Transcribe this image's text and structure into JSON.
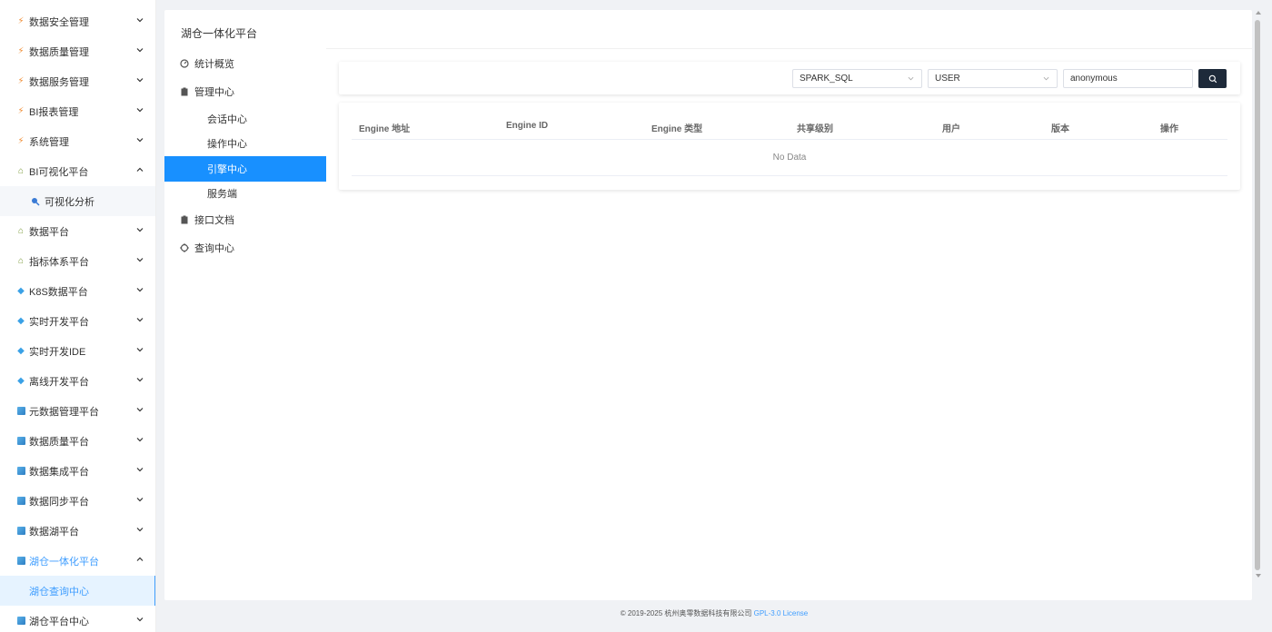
{
  "sidebar": {
    "items": [
      {
        "label": "数据安全管理",
        "icon": "bolt-icon",
        "expanded": false
      },
      {
        "label": "数据质量管理",
        "icon": "bolt-icon",
        "expanded": false
      },
      {
        "label": "数据服务管理",
        "icon": "bolt-icon",
        "expanded": false
      },
      {
        "label": "BI报表管理",
        "icon": "bolt-icon",
        "expanded": false
      },
      {
        "label": "系统管理",
        "icon": "bolt-icon",
        "expanded": false
      },
      {
        "label": "BI可视化平台",
        "icon": "tree-icon",
        "expanded": true
      },
      {
        "label": "数据平台",
        "icon": "tree-icon",
        "expanded": false
      },
      {
        "label": "指标体系平台",
        "icon": "tree-icon",
        "expanded": false
      },
      {
        "label": "K8S数据平台",
        "icon": "gem-icon",
        "expanded": false
      },
      {
        "label": "实时开发平台",
        "icon": "gem-icon",
        "expanded": false
      },
      {
        "label": "实时开发IDE",
        "icon": "gem-icon",
        "expanded": false
      },
      {
        "label": "离线开发平台",
        "icon": "gem-icon",
        "expanded": false
      },
      {
        "label": "元数据管理平台",
        "icon": "cube-icon",
        "expanded": false
      },
      {
        "label": "数据质量平台",
        "icon": "cube-icon",
        "expanded": false
      },
      {
        "label": "数据集成平台",
        "icon": "cube-icon",
        "expanded": false
      },
      {
        "label": "数据同步平台",
        "icon": "cube-icon",
        "expanded": false
      },
      {
        "label": "数据湖平台",
        "icon": "cube-icon",
        "expanded": false
      },
      {
        "label": "湖仓一体化平台",
        "icon": "cube-icon",
        "expanded": true
      },
      {
        "label": "湖仓平台中心",
        "icon": "cube-icon",
        "expanded": false
      }
    ],
    "sub_bi": {
      "label": "可视化分析",
      "icon": "search-icon"
    },
    "sub_lake": {
      "label": "湖仓查询中心"
    }
  },
  "main": {
    "title": "湖仓一体化平台",
    "nav": {
      "overview": "统计概览",
      "manage": "管理中心",
      "session": "会话中心",
      "operation": "操作中心",
      "engine": "引擎中心",
      "server": "服务端",
      "api_doc": "接口文档",
      "query": "查询中心"
    },
    "filter": {
      "engine_type": "SPARK_SQL",
      "share_level": "USER",
      "user": "anonymous"
    },
    "table": {
      "columns": [
        "Engine 地址",
        "Engine ID",
        "Engine 类型",
        "共享级别",
        "用户",
        "版本",
        "操作"
      ],
      "empty_text": "No Data"
    }
  },
  "footer": {
    "copyright": "© 2019-2025 杭州奥零数据科技有限公司",
    "license": "GPL-3.0 License"
  },
  "colors": {
    "accent": "#409eff",
    "selected_bg": "#1890ff",
    "search_btn": "#1e2a3a"
  }
}
